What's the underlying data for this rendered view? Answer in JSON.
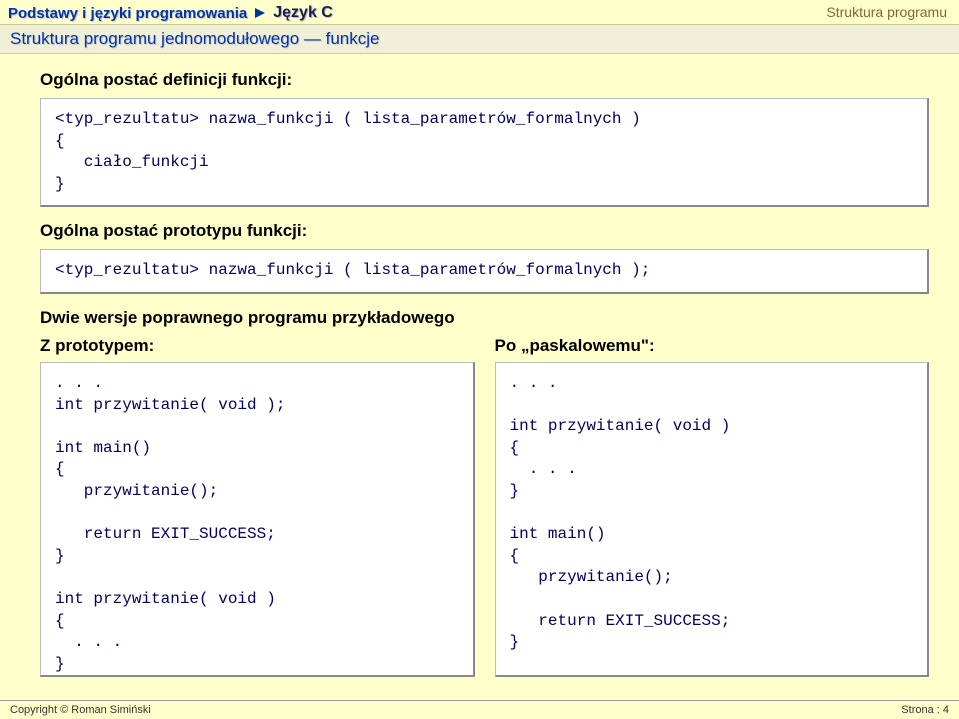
{
  "breadcrumb": {
    "parent": "Podstawy i języki programowania",
    "current": "Język C"
  },
  "header_right": "Struktura programu",
  "subtitle": "Struktura programu jednomodułowego — funkcje",
  "sections": {
    "def_title": "Ogólna postać definicji funkcji:",
    "def_code": "<typ_rezultatu> nazwa_funkcji ( lista_parametrów_formalnych )\n{\n   ciało_funkcji\n}",
    "proto_title": "Ogólna postać prototypu funkcji:",
    "proto_code": "<typ_rezultatu> nazwa_funkcji ( lista_parametrów_formalnych );",
    "two_versions_title": "Dwie wersje poprawnego programu przykładowego",
    "left_col_title": "Z prototypem:",
    "right_col_title": "Po „paskalowemu\":",
    "left_code": ". . .\nint przywitanie( void );\n\nint main()\n{\n   przywitanie();\n\n   return EXIT_SUCCESS;\n}\n\nint przywitanie( void )\n{\n  . . .\n}",
    "right_code": ". . .\n\nint przywitanie( void )\n{\n  . . .\n}\n\nint main()\n{\n   przywitanie();\n\n   return EXIT_SUCCESS;\n}"
  },
  "footer": {
    "copyright": "Copyright © Roman Simiński",
    "page": "Strona : 4"
  }
}
